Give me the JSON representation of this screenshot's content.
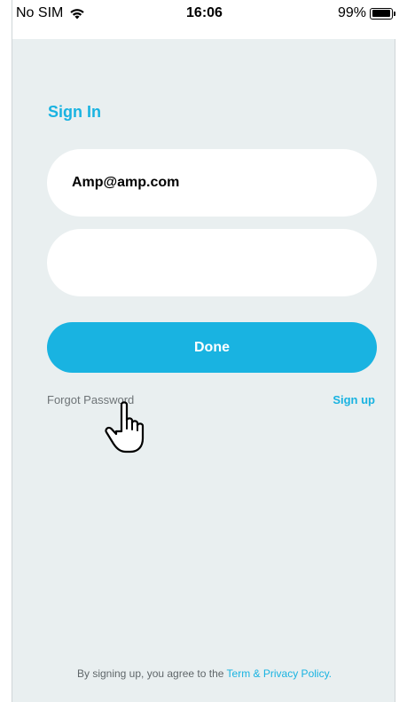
{
  "status_bar": {
    "carrier": "No SIM",
    "time": "16:06",
    "battery": "99%",
    "battery_level": 0.99
  },
  "sign_in": {
    "title": "Sign In",
    "email_value": "Amp@amp.com",
    "password_value": "",
    "done_label": "Done",
    "forgot_label": "Forgot Password",
    "signup_label": "Sign up"
  },
  "footer": {
    "prefix": "By signing up, you agree to the ",
    "link": "Term & Privacy Policy."
  },
  "colors": {
    "accent": "#19b3e1",
    "background": "#e9eff0",
    "field": "#ffffff"
  },
  "icons": [
    "wifi-icon",
    "battery-icon",
    "hand-cursor-icon"
  ]
}
